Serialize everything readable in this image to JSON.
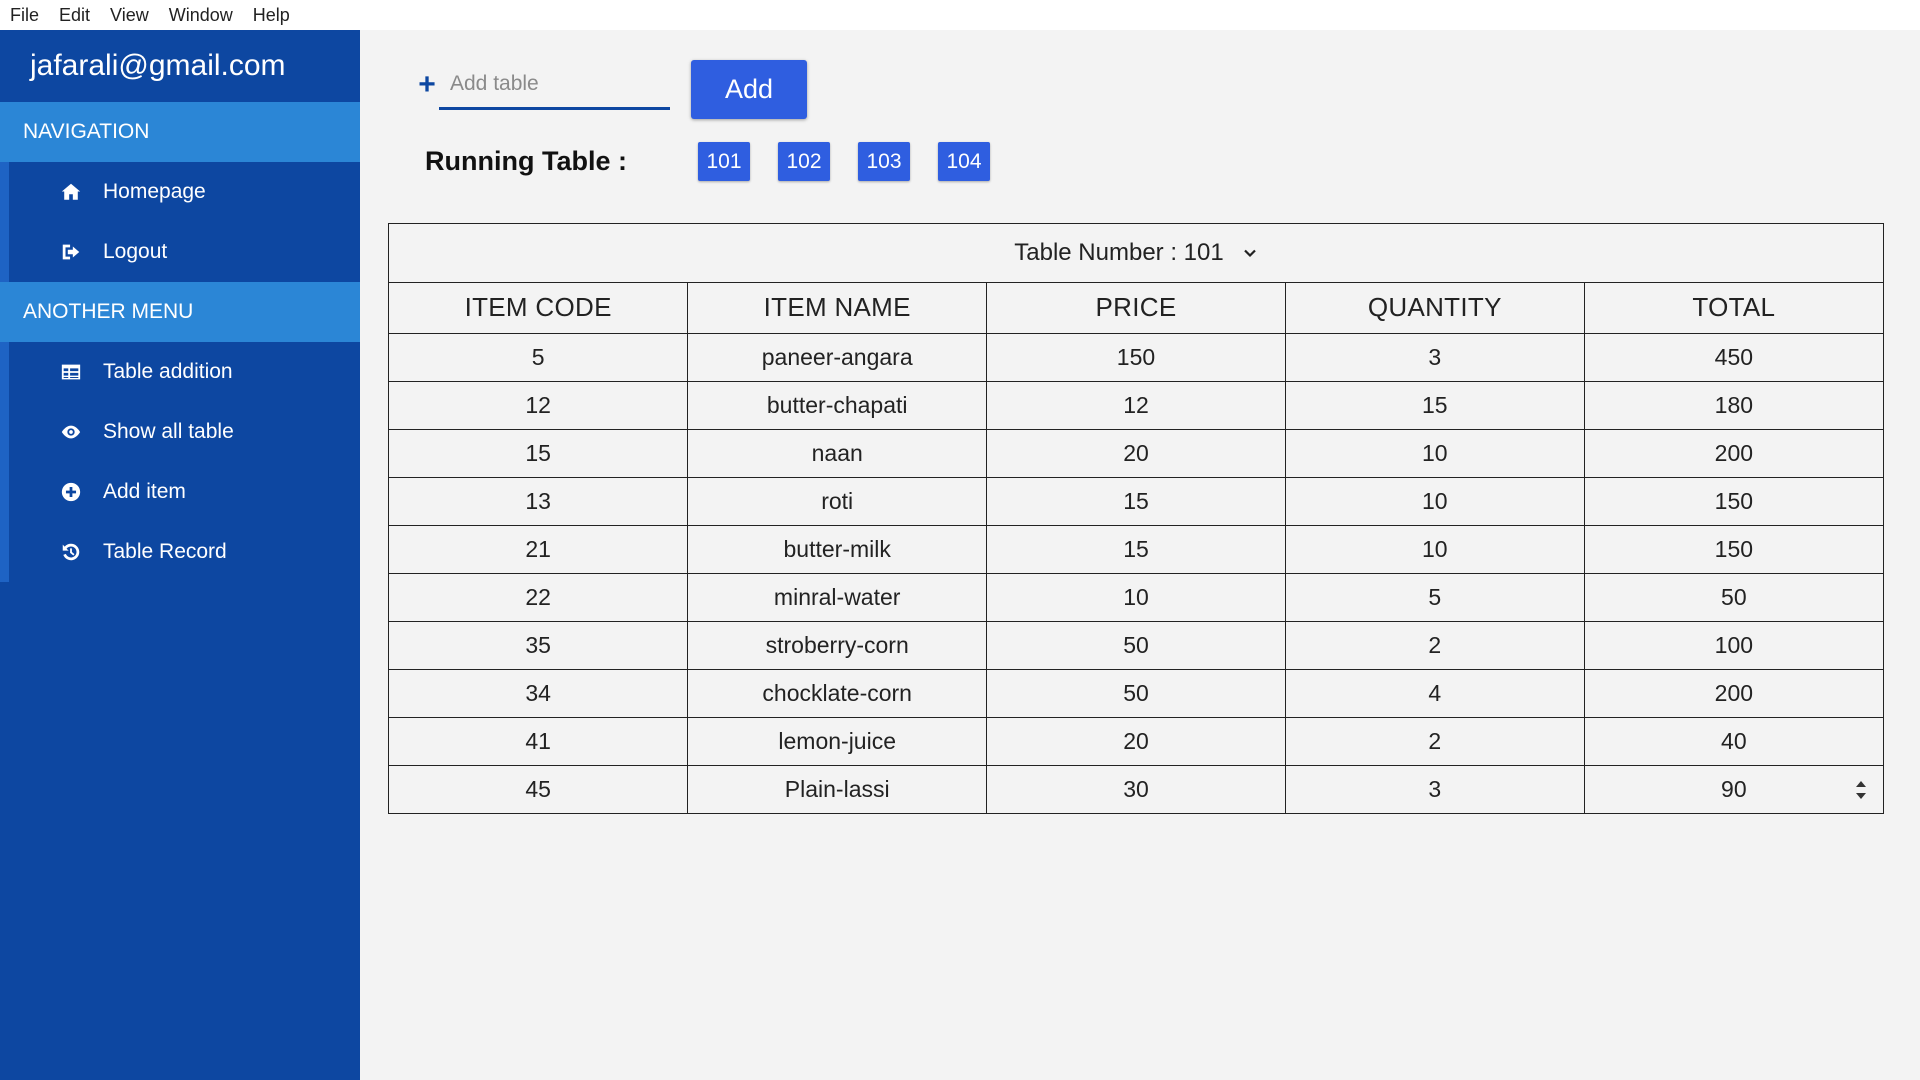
{
  "menubar": {
    "items": [
      "File",
      "Edit",
      "View",
      "Window",
      "Help"
    ]
  },
  "sidebar": {
    "account": "jafarali@gmail.com",
    "sections": [
      {
        "header": "NAVIGATION",
        "items": [
          {
            "label": "Homepage",
            "icon": "home-icon"
          },
          {
            "label": "Logout",
            "icon": "logout-icon"
          }
        ]
      },
      {
        "header": "ANOTHER MENU",
        "items": [
          {
            "label": "Table addition",
            "icon": "table-icon"
          },
          {
            "label": "Show all table",
            "icon": "eye-icon"
          },
          {
            "label": "Add item",
            "icon": "plus-circle-icon"
          },
          {
            "label": "Table Record",
            "icon": "history-icon"
          }
        ]
      }
    ]
  },
  "add_table": {
    "placeholder": "Add table",
    "value": "",
    "button_label": "Add"
  },
  "running": {
    "label": "Running Table :",
    "tables": [
      "101",
      "102",
      "103",
      "104"
    ]
  },
  "order_table": {
    "title": "Table Number : 101",
    "columns": [
      "ITEM CODE",
      "ITEM NAME",
      "PRICE",
      "QUANTITY",
      "TOTAL"
    ],
    "rows": [
      [
        "5",
        "paneer-angara",
        "150",
        "3",
        "450"
      ],
      [
        "12",
        "butter-chapati",
        "12",
        "15",
        "180"
      ],
      [
        "15",
        "naan",
        "20",
        "10",
        "200"
      ],
      [
        "13",
        "roti",
        "15",
        "10",
        "150"
      ],
      [
        "21",
        "butter-milk",
        "15",
        "10",
        "150"
      ],
      [
        "22",
        "minral-water",
        "10",
        "5",
        "50"
      ],
      [
        "35",
        "stroberry-corn",
        "50",
        "2",
        "100"
      ],
      [
        "34",
        "chocklate-corn",
        "50",
        "4",
        "200"
      ],
      [
        "41",
        "lemon-juice",
        "20",
        "2",
        "40"
      ],
      [
        "45",
        "Plain-lassi",
        "30",
        "3",
        "90"
      ]
    ]
  },
  "colors": {
    "sidebar_bg": "#0d47a1",
    "section_header_bg": "#2b86d6",
    "accent_button": "#2f5ee0",
    "page_bg": "#f3f3f3"
  }
}
